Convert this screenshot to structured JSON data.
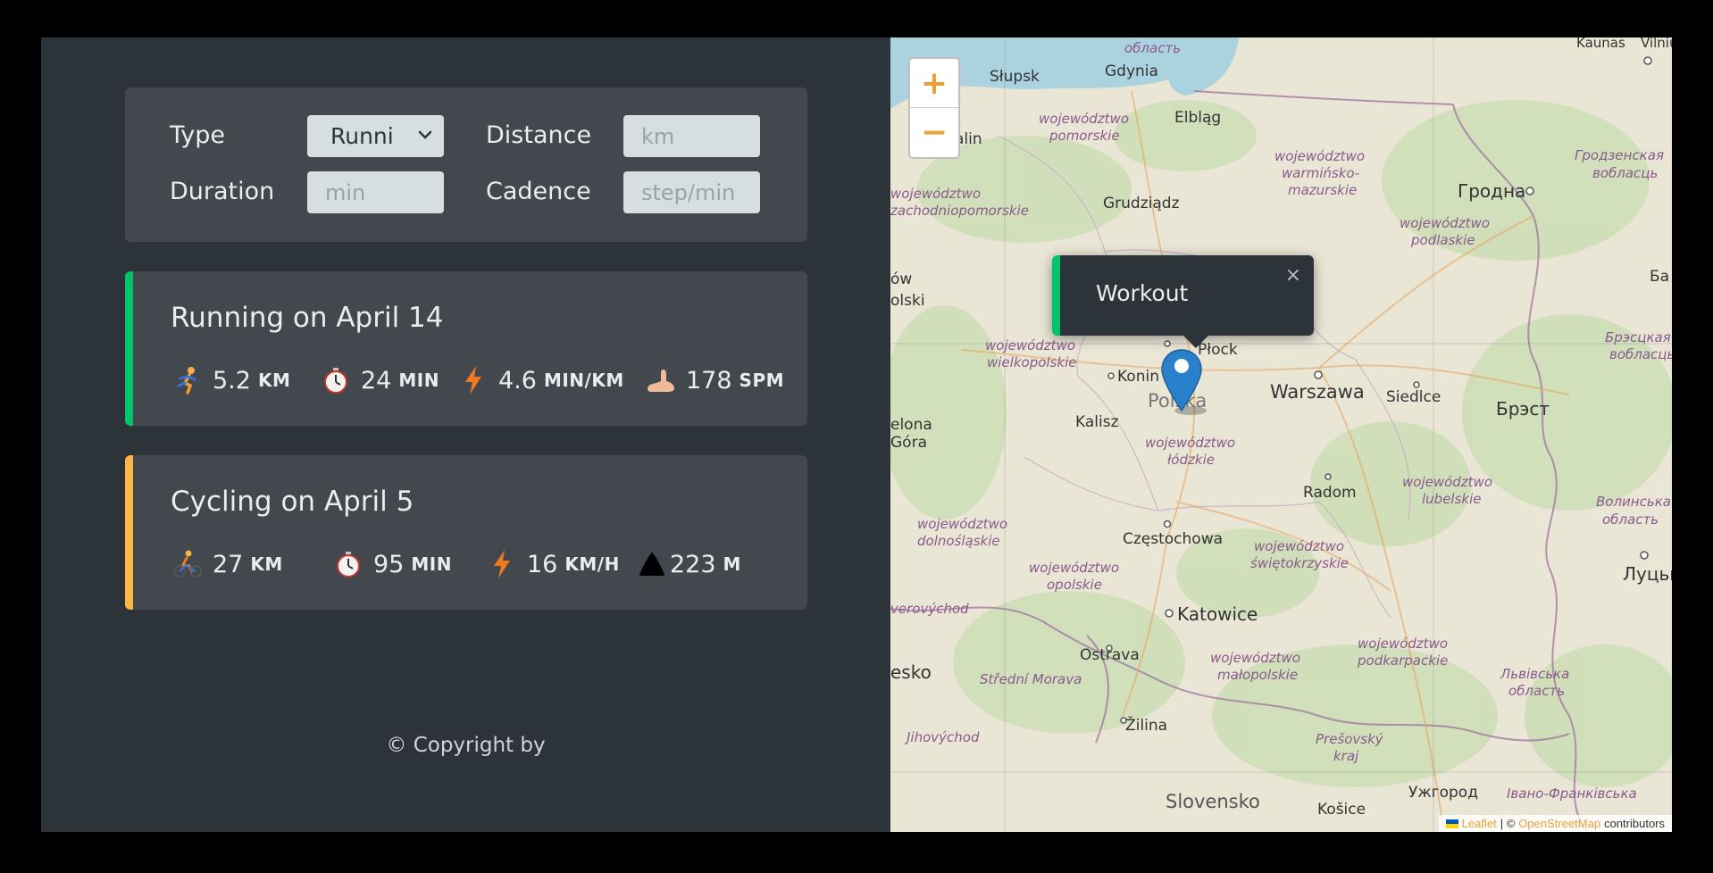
{
  "form": {
    "type_label": "Type",
    "type_value": "Running",
    "distance_label": "Distance",
    "distance_placeholder": "km",
    "duration_label": "Duration",
    "duration_placeholder": "min",
    "cadence_label": "Cadence",
    "cadence_placeholder": "step/min"
  },
  "workouts": [
    {
      "title": "Running on April 14",
      "color": "#00c46a",
      "details": [
        {
          "icon": "runner-icon",
          "value": "5.2",
          "unit": "KM"
        },
        {
          "icon": "stopwatch-icon",
          "value": "24",
          "unit": "MIN"
        },
        {
          "icon": "lightning-icon",
          "value": "4.6",
          "unit": "MIN/KM"
        },
        {
          "icon": "foot-icon",
          "value": "178",
          "unit": "SPM"
        }
      ]
    },
    {
      "title": "Cycling on April 5",
      "color": "#ffb545",
      "details": [
        {
          "icon": "cyclist-icon",
          "value": "27",
          "unit": "KM"
        },
        {
          "icon": "stopwatch-icon",
          "value": "95",
          "unit": "MIN"
        },
        {
          "icon": "lightning-icon",
          "value": "16",
          "unit": "KM/H"
        },
        {
          "icon": "mountain-icon",
          "value": "223",
          "unit": "M"
        }
      ]
    }
  ],
  "copyright": "© Copyright by",
  "map": {
    "zoom_in": "+",
    "zoom_out": "−",
    "popup_text": "Workout",
    "popup_close": "×",
    "attribution_leaflet": "Leaflet",
    "attribution_sep": "| ©",
    "attribution_osm": "OpenStreetMap",
    "attribution_tail": "contributors",
    "labels": {
      "oblast_top": "область",
      "kaunas": "Kaunas",
      "vilnius": "Vilnius",
      "slupsk": "Słupsk",
      "gdynia": "Gdynia",
      "elblag": "Elbląg",
      "alin": "alin",
      "woj_pomorskie_1": "województwo",
      "woj_pomorskie_2": "pomorskie",
      "woj_warm_1": "województwo",
      "woj_warm_2": "warmińsko-",
      "woj_warm_3": "mazurskie",
      "grodz_1": "Гродзенская",
      "grodz_2": "вобласць",
      "hrodna": "Гродна",
      "grudziadz": "Grudziądz",
      "zach_1": "województwo",
      "zach_2": "zachodniopomorskie",
      "podl_1": "województwo",
      "podl_2": "podlaskie",
      "ow": "ów",
      "olski": "olski",
      "plock": "Płock",
      "wlkp_1": "województwo",
      "wlkp_2": "wielkopolskie",
      "konin": "Konin",
      "warszawa": "Warszawa",
      "siedlce": "Siedlce",
      "brest": "Брэст",
      "brest_obl_1": "Брэсцкая",
      "brest_obl_2": "вобласць",
      "kalisz": "Kalisz",
      "polska": "Polska",
      "lodz_1": "województwo",
      "lodz_2": "łódzkie",
      "elona": "elona",
      "gora": "Góra",
      "radom": "Radom",
      "lub_1": "województwo",
      "lub_2": "lubelskie",
      "volyn_1": "Волинська",
      "volyn_2": "область",
      "dolno_1": "województwo",
      "dolno_2": "dolnośląskie",
      "czestochowa": "Częstochowa",
      "swiet_1": "województwo",
      "swiet_2": "świętokrzyskie",
      "opol_1": "województwo",
      "opol_2": "opolskie",
      "lutsk": "Луцьк",
      "verovychod": "verovýchod",
      "katowice": "Katowice",
      "ostrava": "Ostrava",
      "malo_1": "województwo",
      "malo_2": "małopolskie",
      "podk_1": "województwo",
      "podk_2": "podkarpackie",
      "lviv_1": "Львівська",
      "lviv_2": "область",
      "esko": "esko",
      "stredni": "Střední Morava",
      "jihovychod": "Jihovýchod",
      "zilina": "Žilina",
      "presov_1": "Prešovský",
      "presov_2": "kraj",
      "uzhhorod": "Ужгород",
      "slovensko": "Slovensko",
      "kosice": "Košice",
      "ivano_1": "Івано-Франківська",
      "ba": "Ба"
    }
  }
}
